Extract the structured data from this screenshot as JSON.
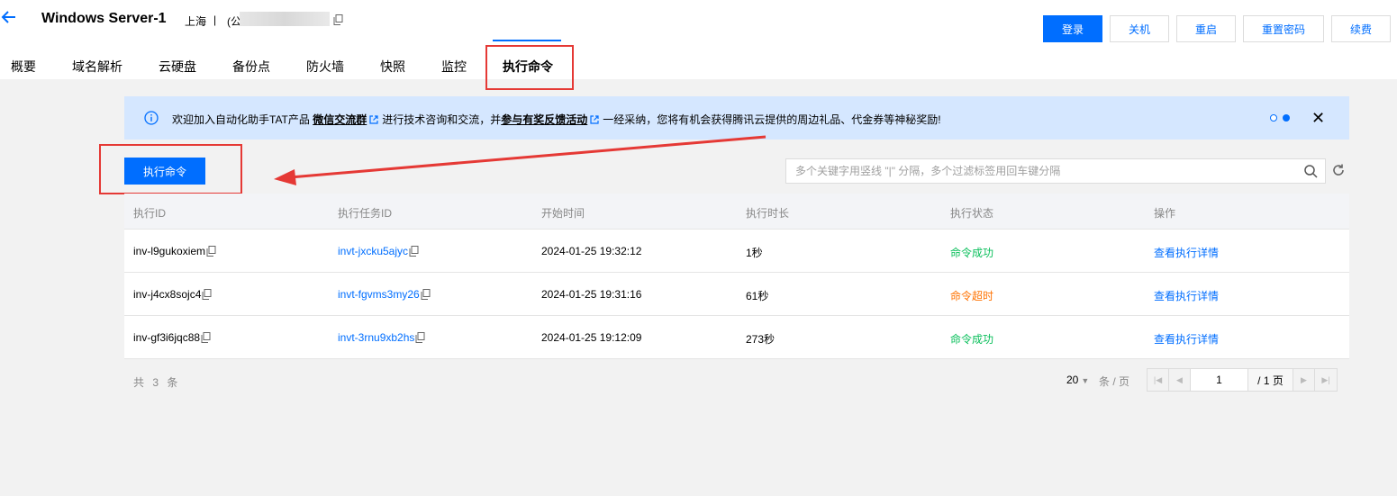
{
  "header": {
    "back_icon": "arrow-left-icon",
    "title": "Windows Server-1",
    "region": "上海",
    "separator": "|",
    "ip_prefix": "(公",
    "actions": [
      {
        "label": "登录",
        "primary": true
      },
      {
        "label": "关机",
        "primary": false
      },
      {
        "label": "重启",
        "primary": false
      },
      {
        "label": "重置密码",
        "primary": false
      },
      {
        "label": "续费",
        "primary": false
      }
    ]
  },
  "tabs": [
    "概要",
    "域名解析",
    "云硬盘",
    "备份点",
    "防火墙",
    "快照",
    "监控",
    "执行命令"
  ],
  "active_tab": "执行命令",
  "notice": {
    "text1": "欢迎加入自动化助手TAT产品 ",
    "link1": "微信交流群",
    "text2": "进行技术咨询和交流，并",
    "link2": "参与有奖反馈活动",
    "text3": "一经采纳，您将有机会获得腾讯云提供的周边礼品、代金券等神秘奖励!"
  },
  "toolbar": {
    "exec_button": "执行命令",
    "search_placeholder": "多个关键字用竖线 \"|\" 分隔，多个过滤标签用回车键分隔"
  },
  "table": {
    "columns": [
      "执行ID",
      "执行任务ID",
      "开始时间",
      "执行时长",
      "执行状态",
      "操作"
    ],
    "rows": [
      {
        "id": "inv-l9gukoxiem",
        "task_id": "invt-jxcku5ajyc",
        "start": "2024-01-25 19:32:12",
        "duration": "1秒",
        "status": "命令成功",
        "status_type": "ok",
        "action": "查看执行详情"
      },
      {
        "id": "inv-j4cx8sojc4",
        "task_id": "invt-fgvms3my26",
        "start": "2024-01-25 19:31:16",
        "duration": "61秒",
        "status": "命令超时",
        "status_type": "warn",
        "action": "查看执行详情"
      },
      {
        "id": "inv-gf3i6jqc88",
        "task_id": "invt-3rnu9xb2hs",
        "start": "2024-01-25 19:12:09",
        "duration": "273秒",
        "status": "命令成功",
        "status_type": "ok",
        "action": "查看执行详情"
      }
    ]
  },
  "pagination": {
    "total": "共 3 条",
    "page_size": "20",
    "per_page_label": "条 / 页",
    "current_page": "1",
    "total_pages": "/ 1 页"
  },
  "colors": {
    "primary": "#006eff",
    "success": "#0abf5b",
    "warning": "#ff7200",
    "annotation": "#e53935"
  }
}
